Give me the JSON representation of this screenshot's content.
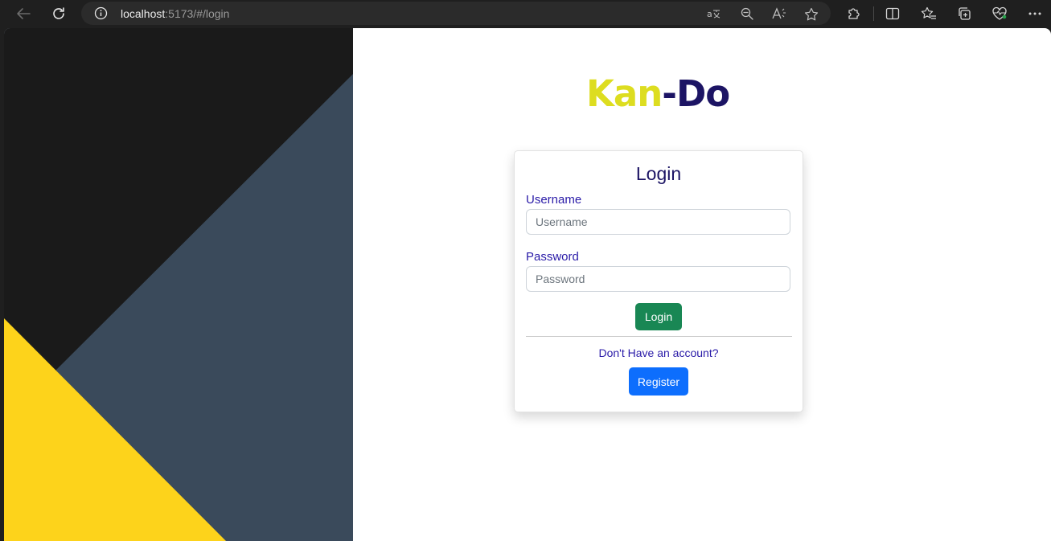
{
  "browser": {
    "url_host": "localhost",
    "url_path": ":5173/#/login"
  },
  "app": {
    "logo_part1": "Kan",
    "logo_part2": "-Do"
  },
  "login_card": {
    "title": "Login",
    "username_label": "Username",
    "username_placeholder": "Username",
    "username_value": "",
    "password_label": "Password",
    "password_placeholder": "Password",
    "password_value": "",
    "login_button": "Login",
    "no_account_text": "Don't Have an account?",
    "register_button": "Register"
  },
  "icons": {
    "back": "back-arrow-icon",
    "refresh": "refresh-icon",
    "site_info": "info-icon",
    "translate": "translate-icon",
    "zoom": "zoom-out-icon",
    "read_aloud": "read-aloud-icon",
    "favorite": "star-icon",
    "extensions": "puzzle-icon",
    "split_screen": "split-screen-icon",
    "favorites_bar": "favorites-icon",
    "collections": "collections-icon",
    "performance": "heart-pulse-icon",
    "more": "more-icon"
  },
  "colors": {
    "logo_yellow": "#dddd20",
    "logo_navy": "#1c1464",
    "login_green": "#198754",
    "register_blue": "#0d6efd",
    "art_black": "#1a1a1a",
    "art_slate": "#3a4a5b",
    "art_yellow": "#fdd31b"
  }
}
